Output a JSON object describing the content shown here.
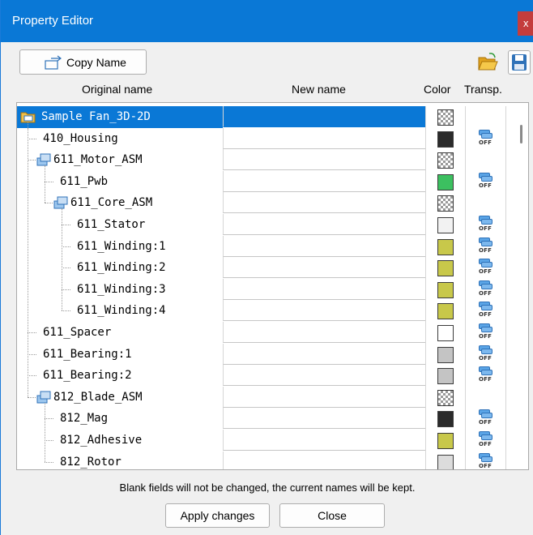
{
  "window": {
    "title": "Property Editor",
    "close_glyph": "x"
  },
  "toolbar": {
    "copy_name_label": "Copy Name",
    "open_icon": "folder-open-icon",
    "save_icon": "floppy-save-icon"
  },
  "columns": {
    "original": "Original name",
    "new": "New name",
    "color": "Color",
    "transp": "Transp."
  },
  "rows": [
    {
      "name": "Sample Fan_3D-2D",
      "depth": 0,
      "icon": "root-folder-icon",
      "color": "checker",
      "transp": false,
      "selected": true
    },
    {
      "name": "410_Housing",
      "depth": 1,
      "icon": "",
      "color": "#2b2b2b",
      "transp": true
    },
    {
      "name": "611_Motor_ASM",
      "depth": 1,
      "icon": "assembly-icon",
      "color": "checker",
      "transp": false
    },
    {
      "name": "611_Pwb",
      "depth": 2,
      "icon": "",
      "color": "#3cc060",
      "transp": true
    },
    {
      "name": "611_Core_ASM",
      "depth": 2,
      "icon": "assembly-icon",
      "color": "checker",
      "transp": false
    },
    {
      "name": "611_Stator",
      "depth": 3,
      "icon": "",
      "color": "#f2f2f2",
      "transp": true
    },
    {
      "name": "611_Winding:1",
      "depth": 3,
      "icon": "",
      "color": "#c8c84a",
      "transp": true
    },
    {
      "name": "611_Winding:2",
      "depth": 3,
      "icon": "",
      "color": "#c8c84a",
      "transp": true
    },
    {
      "name": "611_Winding:3",
      "depth": 3,
      "icon": "",
      "color": "#c8c84a",
      "transp": true
    },
    {
      "name": "611_Winding:4",
      "depth": 3,
      "icon": "",
      "color": "#c8c84a",
      "transp": true
    },
    {
      "name": "611_Spacer",
      "depth": 1,
      "icon": "",
      "color": "#ffffff",
      "transp": true
    },
    {
      "name": "611_Bearing:1",
      "depth": 1,
      "icon": "",
      "color": "#c4c4c4",
      "transp": true
    },
    {
      "name": "611_Bearing:2",
      "depth": 1,
      "icon": "",
      "color": "#c4c4c4",
      "transp": true
    },
    {
      "name": "812_Blade_ASM",
      "depth": 1,
      "icon": "assembly-icon",
      "color": "checker",
      "transp": false
    },
    {
      "name": "812_Mag",
      "depth": 2,
      "icon": "",
      "color": "#2b2b2b",
      "transp": true
    },
    {
      "name": "812_Adhesive",
      "depth": 2,
      "icon": "",
      "color": "#c8c84a",
      "transp": true
    },
    {
      "name": "812_Rotor",
      "depth": 2,
      "icon": "",
      "color": "#dcdcdc",
      "transp": true
    }
  ],
  "transp_off_label": "OFF",
  "footer": {
    "note": "Blank fields will not be changed, the current names will be kept.",
    "apply_label": "Apply changes",
    "close_label": "Close"
  },
  "colors": {
    "titlebar": "#0a78d6",
    "selection": "#0a78d6",
    "close": "#c43d3d"
  }
}
